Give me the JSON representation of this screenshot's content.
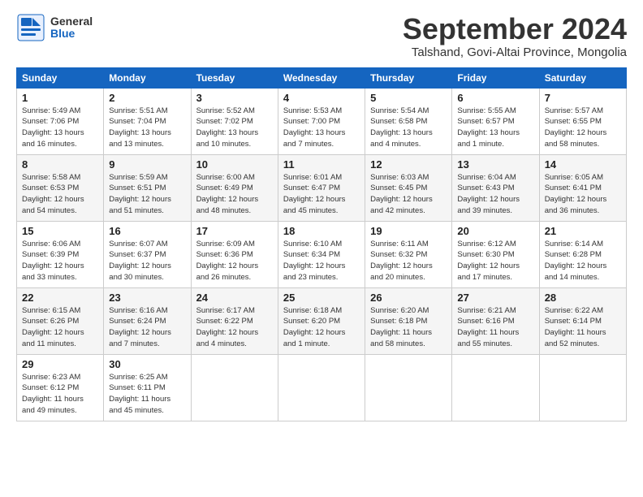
{
  "logo": {
    "general": "General",
    "blue": "Blue"
  },
  "title": "September 2024",
  "location": "Talshand, Govi-Altai Province, Mongolia",
  "headers": [
    "Sunday",
    "Monday",
    "Tuesday",
    "Wednesday",
    "Thursday",
    "Friday",
    "Saturday"
  ],
  "weeks": [
    [
      {
        "day": "1",
        "lines": [
          "Sunrise: 5:49 AM",
          "Sunset: 7:06 PM",
          "Daylight: 13 hours",
          "and 16 minutes."
        ]
      },
      {
        "day": "2",
        "lines": [
          "Sunrise: 5:51 AM",
          "Sunset: 7:04 PM",
          "Daylight: 13 hours",
          "and 13 minutes."
        ]
      },
      {
        "day": "3",
        "lines": [
          "Sunrise: 5:52 AM",
          "Sunset: 7:02 PM",
          "Daylight: 13 hours",
          "and 10 minutes."
        ]
      },
      {
        "day": "4",
        "lines": [
          "Sunrise: 5:53 AM",
          "Sunset: 7:00 PM",
          "Daylight: 13 hours",
          "and 7 minutes."
        ]
      },
      {
        "day": "5",
        "lines": [
          "Sunrise: 5:54 AM",
          "Sunset: 6:58 PM",
          "Daylight: 13 hours",
          "and 4 minutes."
        ]
      },
      {
        "day": "6",
        "lines": [
          "Sunrise: 5:55 AM",
          "Sunset: 6:57 PM",
          "Daylight: 13 hours",
          "and 1 minute."
        ]
      },
      {
        "day": "7",
        "lines": [
          "Sunrise: 5:57 AM",
          "Sunset: 6:55 PM",
          "Daylight: 12 hours",
          "and 58 minutes."
        ]
      }
    ],
    [
      {
        "day": "8",
        "lines": [
          "Sunrise: 5:58 AM",
          "Sunset: 6:53 PM",
          "Daylight: 12 hours",
          "and 54 minutes."
        ]
      },
      {
        "day": "9",
        "lines": [
          "Sunrise: 5:59 AM",
          "Sunset: 6:51 PM",
          "Daylight: 12 hours",
          "and 51 minutes."
        ]
      },
      {
        "day": "10",
        "lines": [
          "Sunrise: 6:00 AM",
          "Sunset: 6:49 PM",
          "Daylight: 12 hours",
          "and 48 minutes."
        ]
      },
      {
        "day": "11",
        "lines": [
          "Sunrise: 6:01 AM",
          "Sunset: 6:47 PM",
          "Daylight: 12 hours",
          "and 45 minutes."
        ]
      },
      {
        "day": "12",
        "lines": [
          "Sunrise: 6:03 AM",
          "Sunset: 6:45 PM",
          "Daylight: 12 hours",
          "and 42 minutes."
        ]
      },
      {
        "day": "13",
        "lines": [
          "Sunrise: 6:04 AM",
          "Sunset: 6:43 PM",
          "Daylight: 12 hours",
          "and 39 minutes."
        ]
      },
      {
        "day": "14",
        "lines": [
          "Sunrise: 6:05 AM",
          "Sunset: 6:41 PM",
          "Daylight: 12 hours",
          "and 36 minutes."
        ]
      }
    ],
    [
      {
        "day": "15",
        "lines": [
          "Sunrise: 6:06 AM",
          "Sunset: 6:39 PM",
          "Daylight: 12 hours",
          "and 33 minutes."
        ]
      },
      {
        "day": "16",
        "lines": [
          "Sunrise: 6:07 AM",
          "Sunset: 6:37 PM",
          "Daylight: 12 hours",
          "and 30 minutes."
        ]
      },
      {
        "day": "17",
        "lines": [
          "Sunrise: 6:09 AM",
          "Sunset: 6:36 PM",
          "Daylight: 12 hours",
          "and 26 minutes."
        ]
      },
      {
        "day": "18",
        "lines": [
          "Sunrise: 6:10 AM",
          "Sunset: 6:34 PM",
          "Daylight: 12 hours",
          "and 23 minutes."
        ]
      },
      {
        "day": "19",
        "lines": [
          "Sunrise: 6:11 AM",
          "Sunset: 6:32 PM",
          "Daylight: 12 hours",
          "and 20 minutes."
        ]
      },
      {
        "day": "20",
        "lines": [
          "Sunrise: 6:12 AM",
          "Sunset: 6:30 PM",
          "Daylight: 12 hours",
          "and 17 minutes."
        ]
      },
      {
        "day": "21",
        "lines": [
          "Sunrise: 6:14 AM",
          "Sunset: 6:28 PM",
          "Daylight: 12 hours",
          "and 14 minutes."
        ]
      }
    ],
    [
      {
        "day": "22",
        "lines": [
          "Sunrise: 6:15 AM",
          "Sunset: 6:26 PM",
          "Daylight: 12 hours",
          "and 11 minutes."
        ]
      },
      {
        "day": "23",
        "lines": [
          "Sunrise: 6:16 AM",
          "Sunset: 6:24 PM",
          "Daylight: 12 hours",
          "and 7 minutes."
        ]
      },
      {
        "day": "24",
        "lines": [
          "Sunrise: 6:17 AM",
          "Sunset: 6:22 PM",
          "Daylight: 12 hours",
          "and 4 minutes."
        ]
      },
      {
        "day": "25",
        "lines": [
          "Sunrise: 6:18 AM",
          "Sunset: 6:20 PM",
          "Daylight: 12 hours",
          "and 1 minute."
        ]
      },
      {
        "day": "26",
        "lines": [
          "Sunrise: 6:20 AM",
          "Sunset: 6:18 PM",
          "Daylight: 11 hours",
          "and 58 minutes."
        ]
      },
      {
        "day": "27",
        "lines": [
          "Sunrise: 6:21 AM",
          "Sunset: 6:16 PM",
          "Daylight: 11 hours",
          "and 55 minutes."
        ]
      },
      {
        "day": "28",
        "lines": [
          "Sunrise: 6:22 AM",
          "Sunset: 6:14 PM",
          "Daylight: 11 hours",
          "and 52 minutes."
        ]
      }
    ],
    [
      {
        "day": "29",
        "lines": [
          "Sunrise: 6:23 AM",
          "Sunset: 6:12 PM",
          "Daylight: 11 hours",
          "and 49 minutes."
        ]
      },
      {
        "day": "30",
        "lines": [
          "Sunrise: 6:25 AM",
          "Sunset: 6:11 PM",
          "Daylight: 11 hours",
          "and 45 minutes."
        ]
      },
      {
        "day": "",
        "lines": []
      },
      {
        "day": "",
        "lines": []
      },
      {
        "day": "",
        "lines": []
      },
      {
        "day": "",
        "lines": []
      },
      {
        "day": "",
        "lines": []
      }
    ]
  ]
}
